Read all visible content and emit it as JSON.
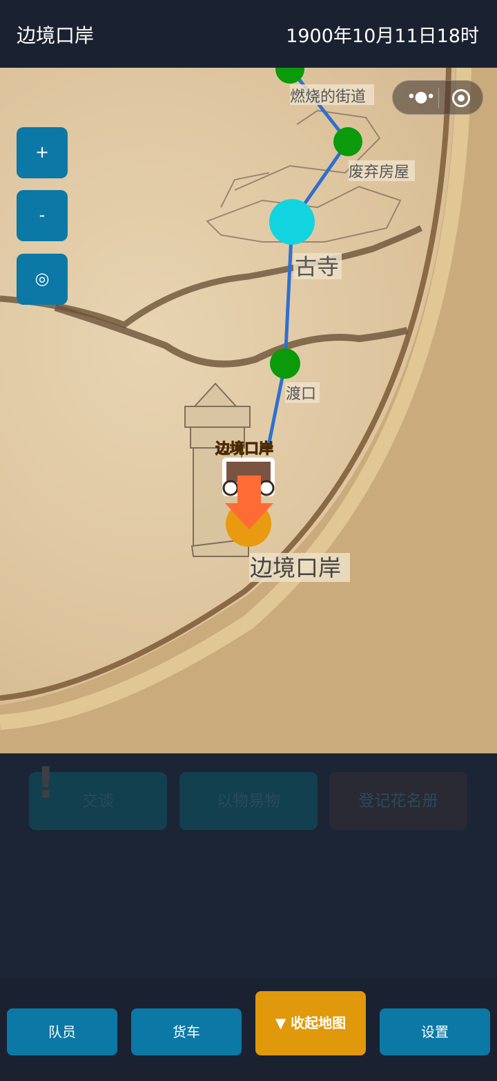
{
  "header": {
    "title": "边境口岸",
    "datetime": "1900年10月11日18时"
  },
  "map": {
    "nodes": [
      {
        "name": "燃烧的街道",
        "color": "#0a9a0a"
      },
      {
        "name": "废弃房屋",
        "color": "#0a9a0a"
      },
      {
        "name": "古寺",
        "color": "#12d4e0"
      },
      {
        "name": "渡口",
        "color": "#0a9a0a"
      },
      {
        "name": "边境口岸",
        "color": "#e89a10"
      }
    ],
    "player_label": "边境口岸",
    "route_color": "#2f6fcf",
    "arrow_color": "#ff6b35"
  },
  "map_controls": {
    "zoom_in": "+",
    "zoom_out": "-",
    "locate": "◎"
  },
  "capsule": {
    "more": "•●•"
  },
  "actions": [
    {
      "label": "交谈",
      "bg": "#12404f"
    },
    {
      "label": "以物易物",
      "bg": "#12404f"
    },
    {
      "label": "登记花名册",
      "bg": "#2a2a34"
    }
  ],
  "notice_icon": "!",
  "nav": {
    "members": "队员",
    "truck": "货车",
    "collapse_map": "▼ 收起地图",
    "settings": "设置"
  }
}
